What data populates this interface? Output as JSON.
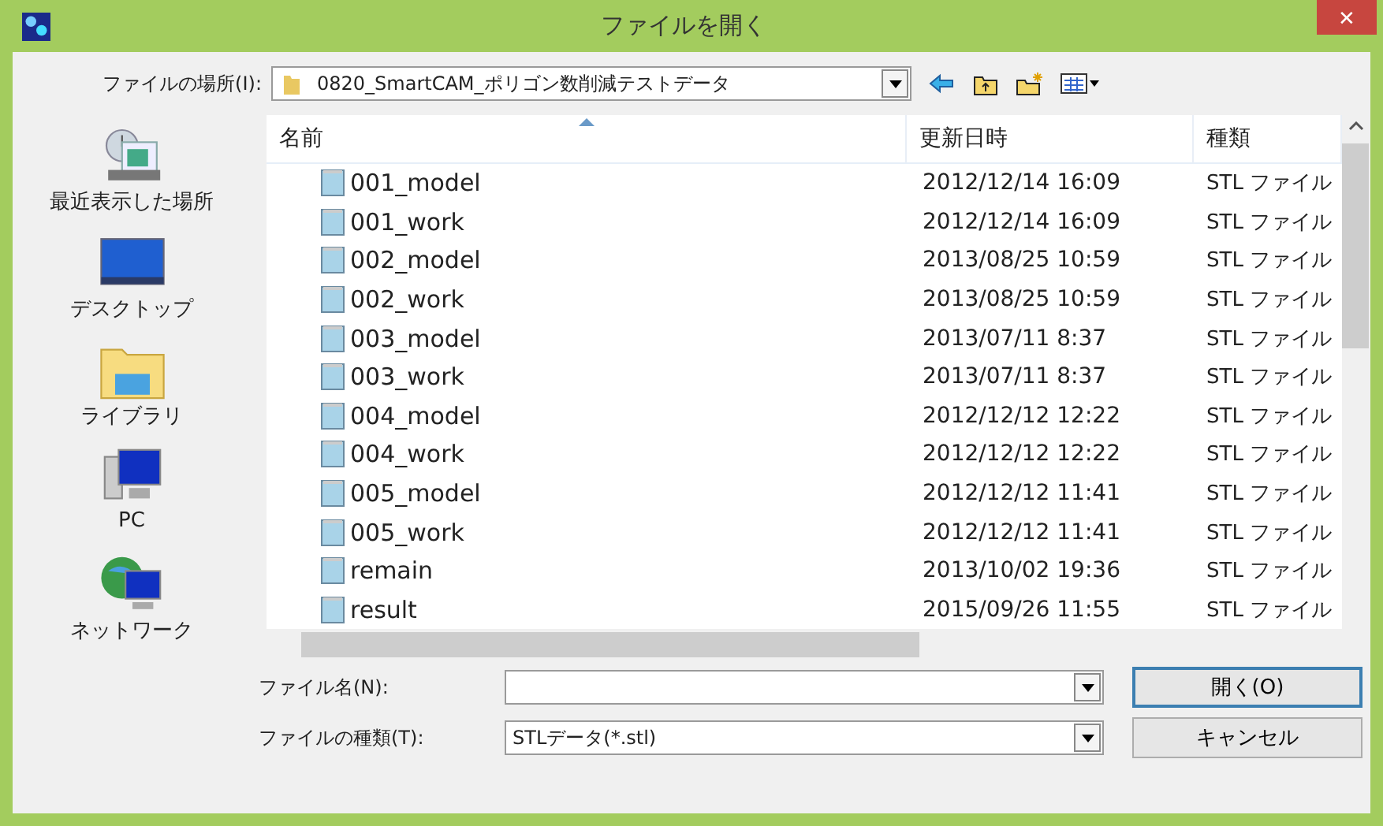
{
  "window": {
    "title": "ファイルを開く",
    "close": "✕"
  },
  "location": {
    "label": "ファイルの場所(I):",
    "value": "0820_SmartCAM_ポリゴン数削減テストデータ"
  },
  "sidebar": {
    "items": [
      {
        "label": "最近表示した場所",
        "kind": "recent",
        "selected": false
      },
      {
        "label": "デスクトップ",
        "kind": "desktop",
        "selected": false
      },
      {
        "label": "ライブラリ",
        "kind": "library",
        "selected": false
      },
      {
        "label": "PC",
        "kind": "pc",
        "selected": false
      },
      {
        "label": "ネットワーク",
        "kind": "network",
        "selected": false
      }
    ]
  },
  "table": {
    "columns": [
      "名前",
      "更新日時",
      "種類"
    ],
    "rows": [
      {
        "name": "001_model",
        "date": "2012/12/14 16:09",
        "type": "STL ファイル"
      },
      {
        "name": "001_work",
        "date": "2012/12/14 16:09",
        "type": "STL ファイル"
      },
      {
        "name": "002_model",
        "date": "2013/08/25 10:59",
        "type": "STL ファイル"
      },
      {
        "name": "002_work",
        "date": "2013/08/25 10:59",
        "type": "STL ファイル"
      },
      {
        "name": "003_model",
        "date": "2013/07/11 8:37",
        "type": "STL ファイル"
      },
      {
        "name": "003_work",
        "date": "2013/07/11 8:37",
        "type": "STL ファイル"
      },
      {
        "name": "004_model",
        "date": "2012/12/12 12:22",
        "type": "STL ファイル"
      },
      {
        "name": "004_work",
        "date": "2012/12/12 12:22",
        "type": "STL ファイル"
      },
      {
        "name": "005_model",
        "date": "2012/12/12 11:41",
        "type": "STL ファイル"
      },
      {
        "name": "005_work",
        "date": "2012/12/12 11:41",
        "type": "STL ファイル"
      },
      {
        "name": "remain",
        "date": "2013/10/02 19:36",
        "type": "STL ファイル"
      },
      {
        "name": "result",
        "date": "2015/09/26 11:55",
        "type": "STL ファイル"
      }
    ]
  },
  "filename": {
    "label": "ファイル名(N):"
  },
  "filetype": {
    "label": "ファイルの種類(T):",
    "value": "STLデータ(*.stl)"
  },
  "buttons": [
    "開く(O)",
    "キャンセル"
  ]
}
